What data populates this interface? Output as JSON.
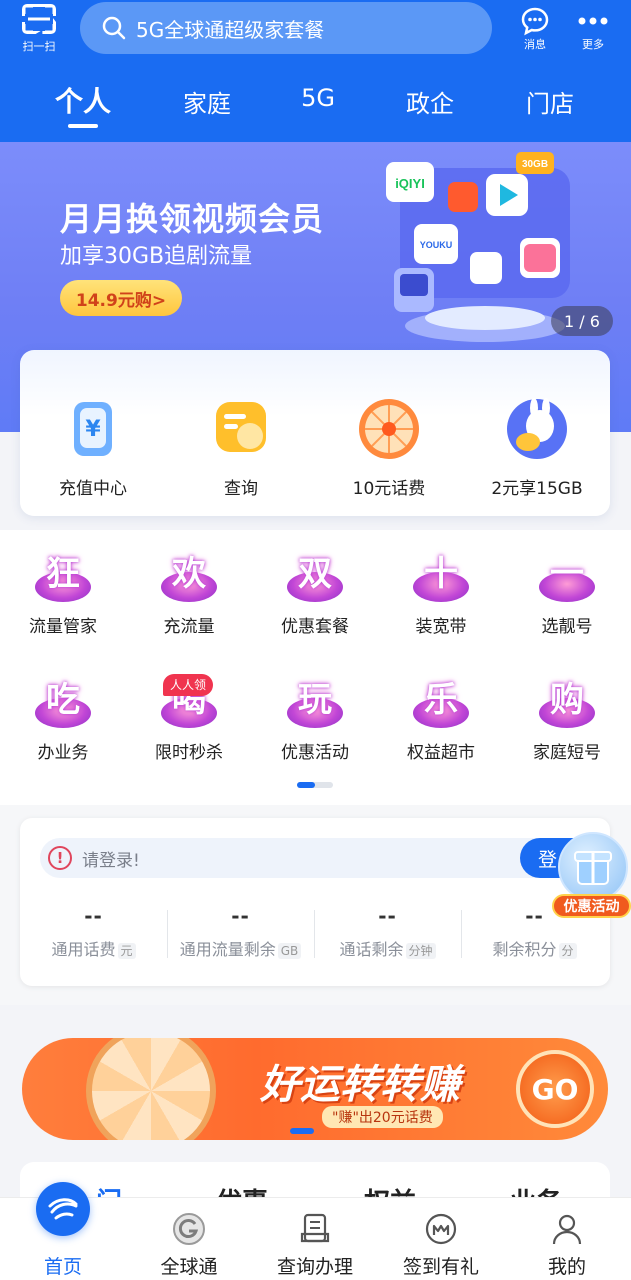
{
  "header": {
    "scan_label": "扫一扫",
    "search_placeholder": "5G全球通超级家套餐",
    "messages_label": "消息",
    "more_label": "更多",
    "accent_color": "#1a6cf2"
  },
  "tabs": [
    {
      "label": "个人",
      "active": true
    },
    {
      "label": "家庭"
    },
    {
      "label": "5G"
    },
    {
      "label": "政企"
    },
    {
      "label": "门店"
    }
  ],
  "banner": {
    "title": "月月换领视频会员",
    "subtitle": "加享30GB追剧流量",
    "cta": "14.9元购>",
    "pager": "1 / 6",
    "app_tiles": [
      "iQIYI",
      "YOUKU",
      "30GB"
    ]
  },
  "quick_actions": [
    {
      "label": "充值中心",
      "icon": "yuan-card-icon"
    },
    {
      "label": "查询",
      "icon": "query-icon"
    },
    {
      "label": "10元话费",
      "icon": "prize-wheel-icon"
    },
    {
      "label": "2元享15GB",
      "icon": "rabbit-coin-icon"
    }
  ],
  "services": [
    {
      "char": "狂",
      "label": "流量管家"
    },
    {
      "char": "欢",
      "label": "充流量"
    },
    {
      "char": "双",
      "label": "优惠套餐"
    },
    {
      "char": "十",
      "label": "装宽带"
    },
    {
      "char": "一",
      "label": "选靓号"
    },
    {
      "char": "吃",
      "label": "办业务"
    },
    {
      "char": "喝",
      "label": "限时秒杀",
      "badge": "人人领"
    },
    {
      "char": "玩",
      "label": "优惠活动"
    },
    {
      "char": "乐",
      "label": "权益超市"
    },
    {
      "char": "购",
      "label": "家庭短号"
    }
  ],
  "login_card": {
    "prompt": "请登录!",
    "button": "登",
    "stats": [
      {
        "value": "--",
        "label": "通用话费",
        "unit": "元"
      },
      {
        "value": "--",
        "label": "通用流量剩余",
        "unit": "GB"
      },
      {
        "value": "--",
        "label": "通话剩余",
        "unit": "分钟"
      },
      {
        "value": "--",
        "label": "剩余积分",
        "unit": "分"
      }
    ]
  },
  "float_promo": {
    "label": "优惠活动"
  },
  "promo_banner": {
    "title": "好运转转赚",
    "subtitle": "\"赚\"出20元话费",
    "go": "GO"
  },
  "next_card_peek": [
    "门",
    "优惠",
    "权益",
    "业务"
  ],
  "bottom_nav": [
    {
      "label": "首页",
      "icon": "china-mobile-logo-icon",
      "active": true
    },
    {
      "label": "全球通",
      "icon": "global-g-icon"
    },
    {
      "label": "查询办理",
      "icon": "document-query-icon"
    },
    {
      "label": "签到有礼",
      "icon": "m-circle-icon"
    },
    {
      "label": "我的",
      "icon": "user-icon"
    }
  ]
}
